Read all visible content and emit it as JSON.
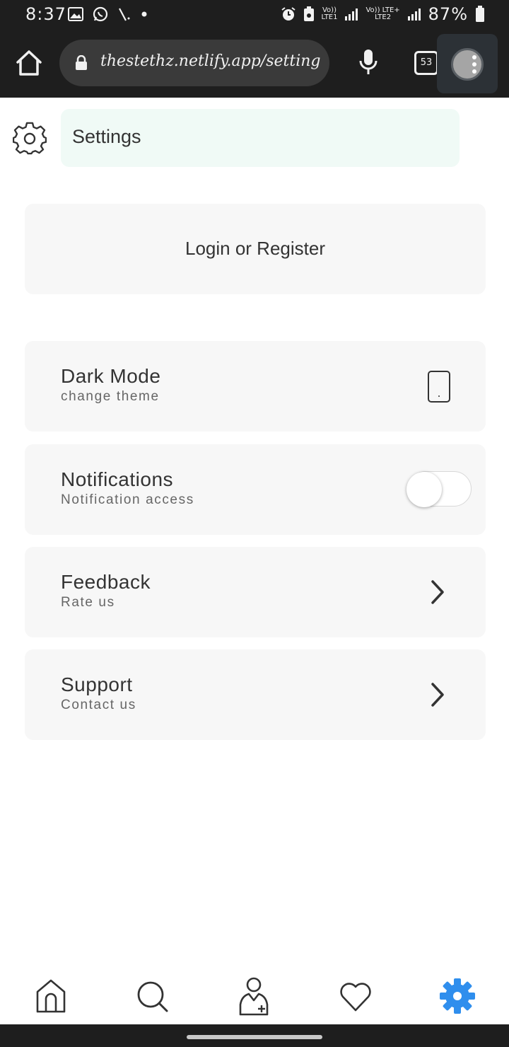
{
  "status_bar": {
    "time": "8:37",
    "battery": "87%",
    "sim1_top": "Vo))",
    "sim1_bottom": "LTE1",
    "sim2_top": "Vo)) LTE+",
    "sim2_bottom": "LTE2"
  },
  "browser": {
    "url": "thestethz.netlify.app/setting",
    "tab_count": "53"
  },
  "header": {
    "title": "Settings",
    "icon": "gear-icon"
  },
  "login": {
    "label": "Login or Register"
  },
  "settings_items": [
    {
      "title": "Dark Mode",
      "subtitle": "change theme",
      "icon": "phone-icon"
    },
    {
      "title": "Notifications",
      "subtitle": "Notification access",
      "toggle_on": false
    },
    {
      "title": "Feedback",
      "subtitle": "Rate us",
      "icon": "chevron-right-icon"
    },
    {
      "title": "Support",
      "subtitle": "Contact us",
      "icon": "chevron-right-icon"
    }
  ],
  "bottom_nav": {
    "items": [
      "home-icon",
      "search-icon",
      "doctor-icon",
      "heart-icon",
      "settings-icon"
    ],
    "active": "settings-icon",
    "active_color": "#2f8eed",
    "inactive_color": "#333333"
  }
}
